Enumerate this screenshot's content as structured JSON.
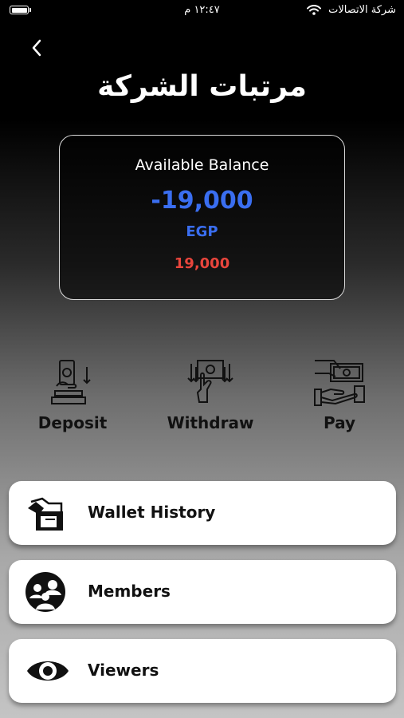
{
  "status_bar": {
    "time": "١٢:٤٧ م",
    "carrier": "شركة الاتصالات"
  },
  "header": {
    "title": "مرتبات الشركة"
  },
  "balance": {
    "label": "Available Balance",
    "amount": "-19,000",
    "currency": "EGP",
    "secondary": "19,000",
    "colors": {
      "amount": "#3a6ef0",
      "secondary": "#e8453c"
    }
  },
  "actions": [
    {
      "label": "Deposit",
      "icon": "deposit-icon"
    },
    {
      "label": "Withdraw",
      "icon": "withdraw-icon"
    },
    {
      "label": "Pay",
      "icon": "pay-icon"
    }
  ],
  "menu": [
    {
      "label": "Wallet History",
      "icon": "wallet-history-icon"
    },
    {
      "label": "Members",
      "icon": "members-icon"
    },
    {
      "label": "Viewers",
      "icon": "eye-icon"
    }
  ]
}
